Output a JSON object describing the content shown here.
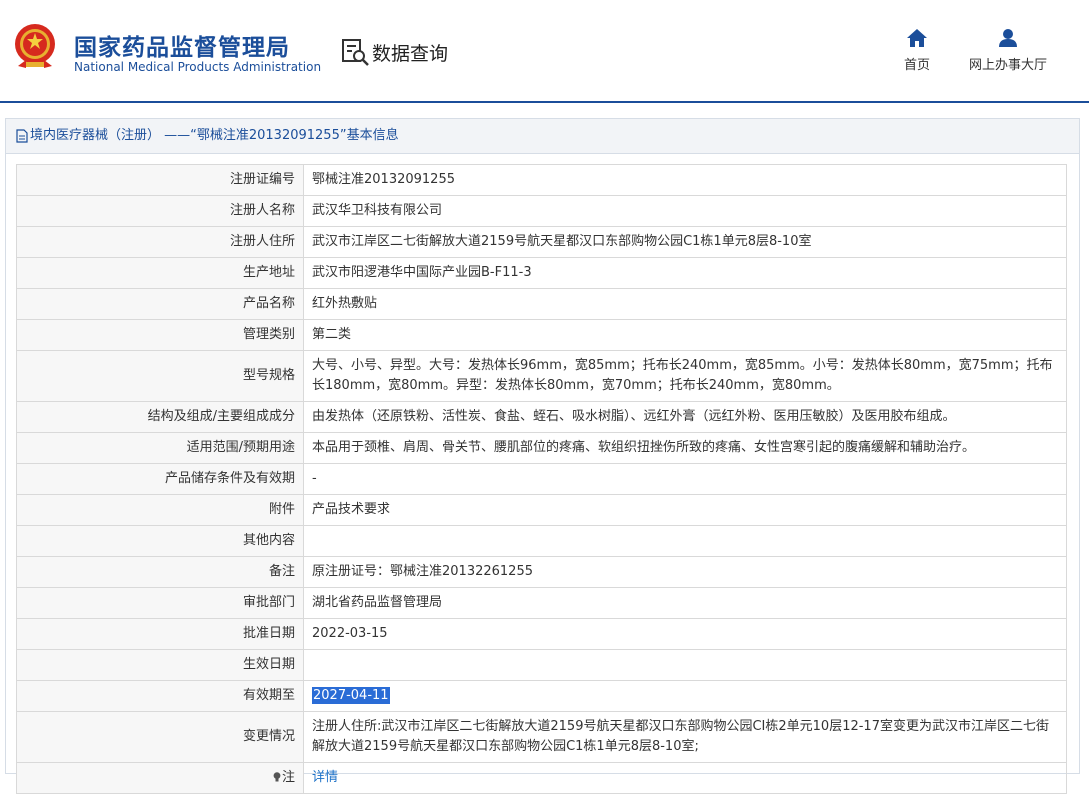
{
  "header": {
    "site_name_cn": "国家药品监督管理局",
    "site_name_en": "National Medical Products Administration",
    "query_title": "数据查询",
    "nav": [
      {
        "label": "首页",
        "icon": "home-icon"
      },
      {
        "label": "网上办事大厅",
        "icon": "user-icon"
      }
    ],
    "brand_color": "#1b4e9a"
  },
  "panel": {
    "title": "境内医疗器械（注册） ——“鄂械注准20132091255”基本信息",
    "rows": [
      {
        "label": "注册证编号",
        "value": "鄂械注准20132091255"
      },
      {
        "label": "注册人名称",
        "value": "武汉华卫科技有限公司"
      },
      {
        "label": "注册人住所",
        "value": "武汉市江岸区二七街解放大道2159号航天星都汉口东部购物公园C1栋1单元8层8-10室"
      },
      {
        "label": "生产地址",
        "value": "武汉市阳逻港华中国际产业园B-F11-3"
      },
      {
        "label": "产品名称",
        "value": "红外热敷贴"
      },
      {
        "label": "管理类别",
        "value": "第二类"
      },
      {
        "label": "型号规格",
        "value": "大号、小号、异型。大号：发热体长96mm，宽85mm；托布长240mm，宽85mm。小号：发热体长80mm，宽75mm；托布长180mm，宽80mm。异型：发热体长80mm，宽70mm；托布长240mm，宽80mm。"
      },
      {
        "label": "结构及组成/主要组成成分",
        "value": "由发热体（还原铁粉、活性炭、食盐、蛭石、吸水树脂）、远红外膏（远红外粉、医用压敏胶）及医用胶布组成。"
      },
      {
        "label": "适用范围/预期用途",
        "value": "本品用于颈椎、肩周、骨关节、腰肌部位的疼痛、软组织扭挫伤所致的疼痛、女性宫寒引起的腹痛缓解和辅助治疗。"
      },
      {
        "label": "产品储存条件及有效期",
        "value": "-"
      },
      {
        "label": "附件",
        "value": "产品技术要求"
      },
      {
        "label": "其他内容",
        "value": ""
      },
      {
        "label": "备注",
        "value": "原注册证号：鄂械注准20132261255"
      },
      {
        "label": "审批部门",
        "value": "湖北省药品监督管理局"
      },
      {
        "label": "批准日期",
        "value": "2022-03-15"
      },
      {
        "label": "生效日期",
        "value": ""
      },
      {
        "label": "有效期至",
        "value": "2027-04-11"
      },
      {
        "label": "变更情况",
        "value": "注册人住所:武汉市江岸区二七街解放大道2159号航天星都汉口东部购物公园CI栋2单元10层12-17室变更为武汉市江岸区二七街解放大道2159号航天星都汉口东部购物公园C1栋1单元8层8-10室;"
      },
      {
        "label": "注",
        "value": "详情"
      }
    ]
  }
}
